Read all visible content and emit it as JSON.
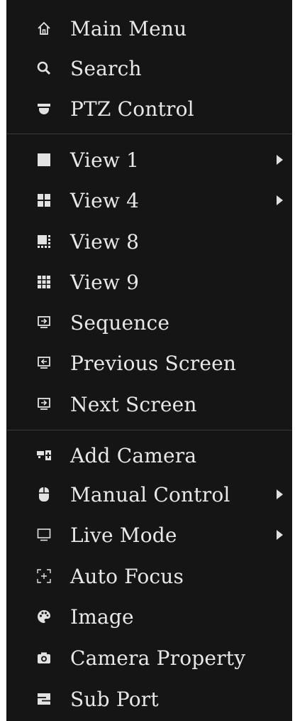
{
  "menu": {
    "items": [
      {
        "label": "Main Menu",
        "icon": "home-icon"
      },
      {
        "label": "Search",
        "icon": "search-icon"
      },
      {
        "label": "PTZ Control",
        "icon": "ptz-dome-icon"
      },
      {
        "label": "View 1",
        "icon": "view1-layout-icon",
        "submenu": true
      },
      {
        "label": "View 4",
        "icon": "view4-layout-icon",
        "submenu": true
      },
      {
        "label": "View 8",
        "icon": "view8-layout-icon"
      },
      {
        "label": "View 9",
        "icon": "view9-layout-icon"
      },
      {
        "label": "Sequence",
        "icon": "sequence-monitor-icon"
      },
      {
        "label": "Previous Screen",
        "icon": "previous-screen-icon"
      },
      {
        "label": "Next Screen",
        "icon": "next-screen-icon"
      },
      {
        "label": "Add Camera",
        "icon": "add-camera-icon"
      },
      {
        "label": "Manual Control",
        "icon": "mouse-icon",
        "submenu": true
      },
      {
        "label": "Live Mode",
        "icon": "monitor-outline-icon",
        "submenu": true
      },
      {
        "label": "Auto Focus",
        "icon": "focus-icon"
      },
      {
        "label": "Image",
        "icon": "palette-icon"
      },
      {
        "label": "Camera Property",
        "icon": "camera-icon"
      },
      {
        "label": "Sub Port",
        "icon": "sub-port-icon"
      }
    ]
  },
  "colors": {
    "background": "#151515",
    "text": "#e8e8e8",
    "separator": "#3a3a3a"
  }
}
